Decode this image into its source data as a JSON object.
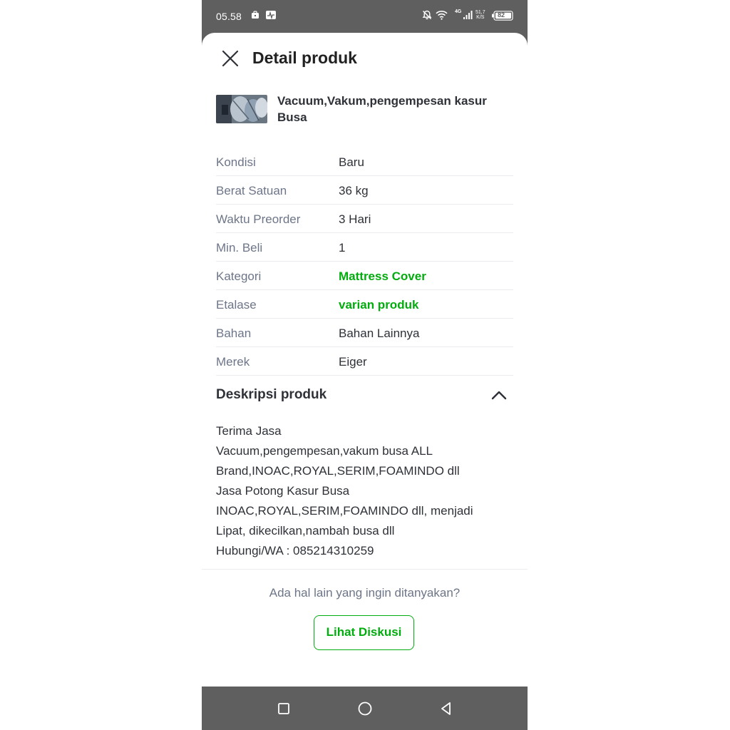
{
  "status_bar": {
    "time": "05.58",
    "network": "4G",
    "speed": "51,7",
    "speed_unit": "K/S",
    "battery": "82",
    "icons": [
      "briefcase-icon",
      "activity-icon",
      "mute-icon",
      "wifi-icon",
      "signal-icon",
      "battery-icon"
    ]
  },
  "header": {
    "title": "Detail produk"
  },
  "product": {
    "name": "Vacuum,Vakum,pengempesan kasur Busa"
  },
  "specs": [
    {
      "label": "Kondisi",
      "value": "Baru",
      "link": false
    },
    {
      "label": "Berat Satuan",
      "value": "36 kg",
      "link": false
    },
    {
      "label": "Waktu Preorder",
      "value": "3 Hari",
      "link": false
    },
    {
      "label": "Min. Beli",
      "value": "1",
      "link": false
    },
    {
      "label": "Kategori",
      "value": "Mattress Cover",
      "link": true
    },
    {
      "label": "Etalase",
      "value": "varian produk",
      "link": true
    },
    {
      "label": "Bahan",
      "value": "Bahan Lainnya",
      "link": false
    },
    {
      "label": "Merek",
      "value": "Eiger",
      "link": false
    }
  ],
  "description": {
    "title": "Deskripsi produk",
    "lines": [
      "Terima Jasa",
      "Vacuum,pengempesan,vakum busa ALL",
      "Brand,INOAC,ROYAL,SERIM,FOAMINDO dll",
      "Jasa Potong Kasur Busa",
      "INOAC,ROYAL,SERIM,FOAMINDO dll, menjadi",
      "Lipat, dikecilkan,nambah busa dll",
      "Hubungi/WA : 085214310259"
    ]
  },
  "footer": {
    "question": "Ada hal lain yang ingin ditanyakan?",
    "button_label": "Lihat Diskusi"
  },
  "colors": {
    "accent_green": "#03ac0e",
    "text_dark": "#2e3137",
    "text_muted": "#6d7588",
    "system_bar": "#5f5f5f"
  }
}
